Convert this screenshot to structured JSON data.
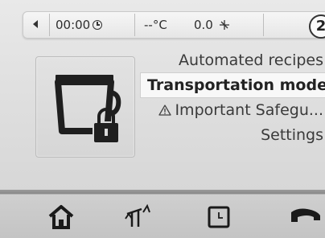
{
  "status_bar": {
    "time": "00:00",
    "temperature": "--°C",
    "weight": "0.0"
  },
  "badge": "2",
  "menu": {
    "items": [
      {
        "label": "Automated recipes",
        "selected": false
      },
      {
        "label": "Transportation mode",
        "selected": true
      },
      {
        "label": "Important Safegu...",
        "selected": false,
        "icon": "warning-icon"
      },
      {
        "label": "Settings",
        "selected": false
      }
    ]
  },
  "tile": {
    "icon": "bowl-lock-icon"
  },
  "bottom_nav": {
    "items": [
      {
        "icon": "home-icon"
      },
      {
        "icon": "scale-icon"
      },
      {
        "icon": "timer-icon"
      },
      {
        "icon": "reverse-icon"
      }
    ]
  }
}
